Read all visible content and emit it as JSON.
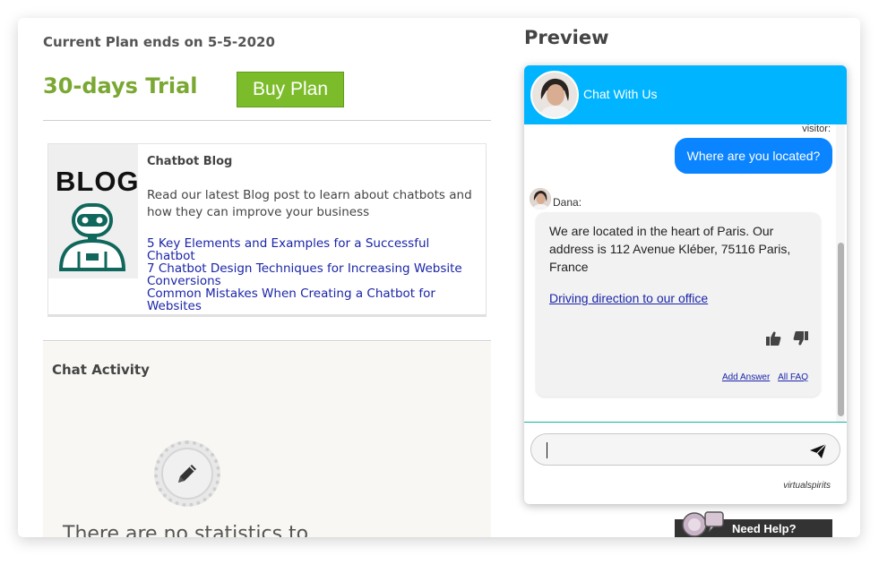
{
  "plan": {
    "ends_text": "Current Plan ends on 5-5-2020",
    "trial_label": "30-days Trial",
    "buy_button": "Buy Plan"
  },
  "blog": {
    "thumb_text": "BLOG",
    "title": "Chatbot Blog",
    "description": "Read our latest Blog post to learn about chatbots and how they can improve your business",
    "links": [
      "5 Key Elements and Examples for a Successful Chatbot",
      "7 Chatbot Design Techniques for Increasing Website Conversions",
      "Common Mistakes When Creating a Chatbot for Websites"
    ]
  },
  "activity": {
    "title": "Chat Activity",
    "empty_text": "There are no statistics to"
  },
  "preview": {
    "title": "Preview",
    "header_title": "Chat With Us",
    "visitor_label": "visitor:",
    "user_message": "Where are you located?",
    "bot_name": "Dana:",
    "bot_message": "We are located in the heart of Paris. Our address is 112 Avenue Kléber, 75116 Paris, France",
    "bot_link": "Driving direction to our office",
    "add_answer": "Add Answer",
    "all_faq": "All FAQ",
    "input_value": "",
    "brand": "virtualspirits"
  },
  "help": {
    "label": "Need Help?"
  },
  "colors": {
    "trial_green": "#7aa832",
    "buy_button_bg": "#7cbc2a",
    "chat_header": "#00b4ff",
    "user_bubble": "#0a84ff",
    "link_blue": "#1a25a8"
  },
  "icons": {
    "robot": "robot-icon",
    "pencil": "pencil-icon",
    "thumbs_up": "thumbs-up-icon",
    "thumbs_down": "thumbs-down-icon",
    "send": "send-icon",
    "help_avatar": "help-avatar-icon"
  }
}
